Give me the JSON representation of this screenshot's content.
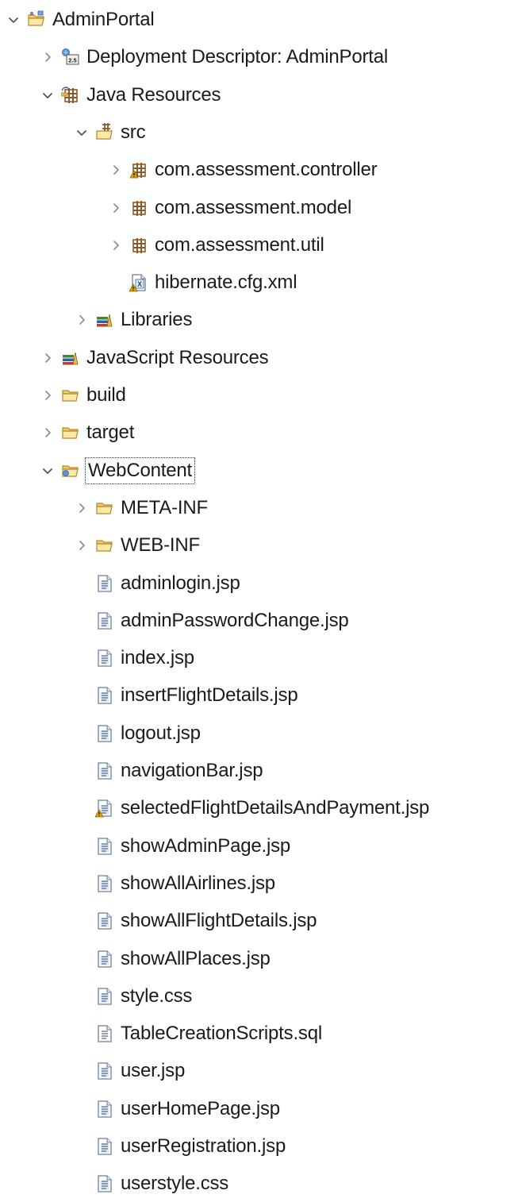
{
  "tree": [
    {
      "label": "AdminPortal",
      "depth": 0,
      "expander": "expanded",
      "icon": "web-project-icon",
      "name": "project-adminportal"
    },
    {
      "label": "Deployment Descriptor: AdminPortal",
      "depth": 1,
      "expander": "collapsed",
      "icon": "deployment-descriptor-icon",
      "name": "node-deployment-descriptor"
    },
    {
      "label": "Java Resources",
      "depth": 1,
      "expander": "expanded",
      "icon": "java-resources-icon",
      "name": "node-java-resources"
    },
    {
      "label": "src",
      "depth": 2,
      "expander": "expanded",
      "icon": "source-folder-icon",
      "name": "node-src"
    },
    {
      "label": "com.assessment.controller",
      "depth": 3,
      "expander": "collapsed",
      "icon": "package-warning-icon",
      "name": "package-controller"
    },
    {
      "label": "com.assessment.model",
      "depth": 3,
      "expander": "collapsed",
      "icon": "package-icon",
      "name": "package-model"
    },
    {
      "label": "com.assessment.util",
      "depth": 3,
      "expander": "collapsed",
      "icon": "package-icon",
      "name": "package-util"
    },
    {
      "label": "hibernate.cfg.xml",
      "depth": 3,
      "expander": "none",
      "icon": "xml-file-warning-icon",
      "name": "file-hibernate-cfg"
    },
    {
      "label": "Libraries",
      "depth": 2,
      "expander": "collapsed",
      "icon": "libraries-icon",
      "name": "node-libraries"
    },
    {
      "label": "JavaScript Resources",
      "depth": 1,
      "expander": "collapsed",
      "icon": "libraries-icon",
      "name": "node-javascript-resources"
    },
    {
      "label": "build",
      "depth": 1,
      "expander": "collapsed",
      "icon": "folder-icon",
      "name": "folder-build"
    },
    {
      "label": "target",
      "depth": 1,
      "expander": "collapsed",
      "icon": "folder-icon",
      "name": "folder-target"
    },
    {
      "label": "WebContent",
      "depth": 1,
      "expander": "expanded",
      "icon": "web-folder-icon",
      "name": "folder-webcontent",
      "focused": true
    },
    {
      "label": "META-INF",
      "depth": 2,
      "expander": "collapsed",
      "icon": "folder-icon",
      "name": "folder-meta-inf"
    },
    {
      "label": "WEB-INF",
      "depth": 2,
      "expander": "collapsed",
      "icon": "folder-icon",
      "name": "folder-web-inf"
    },
    {
      "label": "adminlogin.jsp",
      "depth": 2,
      "expander": "none",
      "icon": "jsp-file-icon",
      "name": "file-adminlogin"
    },
    {
      "label": "adminPasswordChange.jsp",
      "depth": 2,
      "expander": "none",
      "icon": "jsp-file-icon",
      "name": "file-adminpasswordchange"
    },
    {
      "label": "index.jsp",
      "depth": 2,
      "expander": "none",
      "icon": "jsp-file-icon",
      "name": "file-index"
    },
    {
      "label": "insertFlightDetails.jsp",
      "depth": 2,
      "expander": "none",
      "icon": "jsp-file-icon",
      "name": "file-insertflightdetails"
    },
    {
      "label": "logout.jsp",
      "depth": 2,
      "expander": "none",
      "icon": "jsp-file-icon",
      "name": "file-logout"
    },
    {
      "label": "navigationBar.jsp",
      "depth": 2,
      "expander": "none",
      "icon": "jsp-file-icon",
      "name": "file-navigationbar"
    },
    {
      "label": "selectedFlightDetailsAndPayment.jsp",
      "depth": 2,
      "expander": "none",
      "icon": "jsp-file-warning-icon",
      "name": "file-selectedflightdetailsandpayment"
    },
    {
      "label": "showAdminPage.jsp",
      "depth": 2,
      "expander": "none",
      "icon": "jsp-file-icon",
      "name": "file-showadminpage"
    },
    {
      "label": "showAllAirlines.jsp",
      "depth": 2,
      "expander": "none",
      "icon": "jsp-file-icon",
      "name": "file-showallairlines"
    },
    {
      "label": "showAllFlightDetails.jsp",
      "depth": 2,
      "expander": "none",
      "icon": "jsp-file-icon",
      "name": "file-showallflightdetails"
    },
    {
      "label": "showAllPlaces.jsp",
      "depth": 2,
      "expander": "none",
      "icon": "jsp-file-icon",
      "name": "file-showallplaces"
    },
    {
      "label": "style.css",
      "depth": 2,
      "expander": "none",
      "icon": "css-file-icon",
      "name": "file-style-css"
    },
    {
      "label": "TableCreationScripts.sql",
      "depth": 2,
      "expander": "none",
      "icon": "text-file-icon",
      "name": "file-tablecreationscripts"
    },
    {
      "label": "user.jsp",
      "depth": 2,
      "expander": "none",
      "icon": "jsp-file-icon",
      "name": "file-user"
    },
    {
      "label": "userHomePage.jsp",
      "depth": 2,
      "expander": "none",
      "icon": "jsp-file-icon",
      "name": "file-userhomepage"
    },
    {
      "label": "userRegistration.jsp",
      "depth": 2,
      "expander": "none",
      "icon": "jsp-file-icon",
      "name": "file-userregistration"
    },
    {
      "label": "userstyle.css",
      "depth": 2,
      "expander": "none",
      "icon": "css-file-icon",
      "name": "file-userstyle-css"
    }
  ],
  "colors": {
    "text": "#1b1b1b",
    "twisty": "#555555",
    "folder": "#e8b64a",
    "package": "#8a5a2b",
    "warning": "#e0a800",
    "file_fill": "#ffffff",
    "file_stroke": "#6b7f99",
    "library_green": "#3a8a3a",
    "library_blue": "#2f5fa8"
  }
}
